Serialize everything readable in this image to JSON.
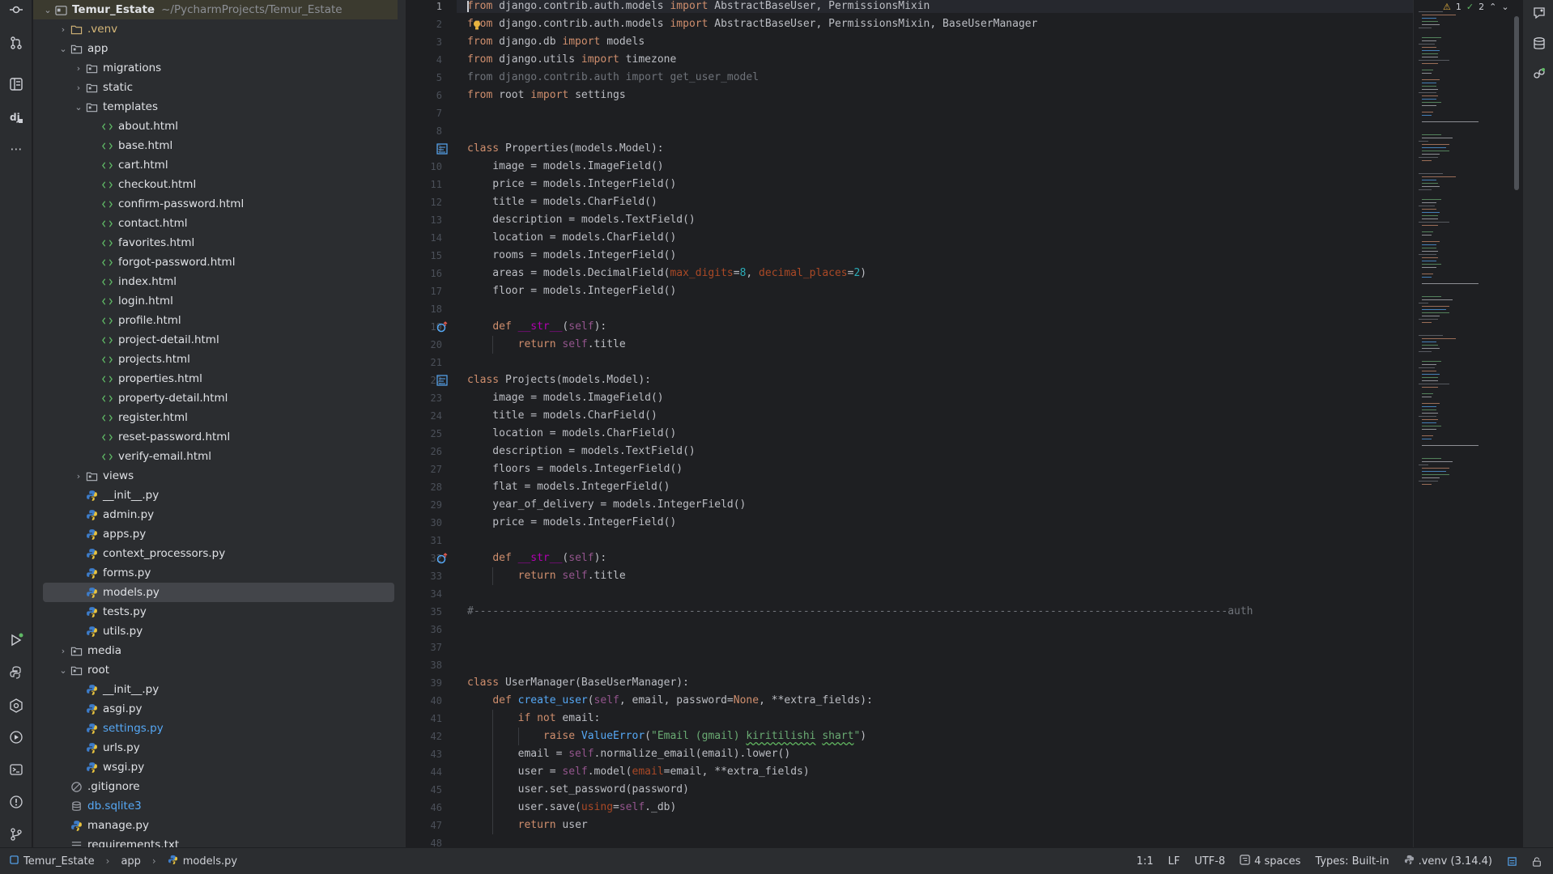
{
  "project_tree": {
    "root_name": "Temur_Estate",
    "root_path": "~/PycharmProjects/Temur_Estate",
    "items": [
      {
        "label": ".venv",
        "depth": 1,
        "type": "folder-venv",
        "expanded": false
      },
      {
        "label": "app",
        "depth": 1,
        "type": "folder",
        "expanded": true
      },
      {
        "label": "migrations",
        "depth": 2,
        "type": "folder",
        "expanded": false
      },
      {
        "label": "static",
        "depth": 2,
        "type": "folder",
        "expanded": false
      },
      {
        "label": "templates",
        "depth": 2,
        "type": "folder",
        "expanded": true
      },
      {
        "label": "about.html",
        "depth": 3,
        "type": "html"
      },
      {
        "label": "base.html",
        "depth": 3,
        "type": "html"
      },
      {
        "label": "cart.html",
        "depth": 3,
        "type": "html"
      },
      {
        "label": "checkout.html",
        "depth": 3,
        "type": "html"
      },
      {
        "label": "confirm-password.html",
        "depth": 3,
        "type": "html"
      },
      {
        "label": "contact.html",
        "depth": 3,
        "type": "html"
      },
      {
        "label": "favorites.html",
        "depth": 3,
        "type": "html"
      },
      {
        "label": "forgot-password.html",
        "depth": 3,
        "type": "html"
      },
      {
        "label": "index.html",
        "depth": 3,
        "type": "html"
      },
      {
        "label": "login.html",
        "depth": 3,
        "type": "html"
      },
      {
        "label": "profile.html",
        "depth": 3,
        "type": "html"
      },
      {
        "label": "project-detail.html",
        "depth": 3,
        "type": "html"
      },
      {
        "label": "projects.html",
        "depth": 3,
        "type": "html"
      },
      {
        "label": "properties.html",
        "depth": 3,
        "type": "html"
      },
      {
        "label": "property-detail.html",
        "depth": 3,
        "type": "html"
      },
      {
        "label": "register.html",
        "depth": 3,
        "type": "html"
      },
      {
        "label": "reset-password.html",
        "depth": 3,
        "type": "html"
      },
      {
        "label": "verify-email.html",
        "depth": 3,
        "type": "html"
      },
      {
        "label": "views",
        "depth": 2,
        "type": "folder",
        "expanded": false
      },
      {
        "label": "__init__.py",
        "depth": 2,
        "type": "py"
      },
      {
        "label": "admin.py",
        "depth": 2,
        "type": "py"
      },
      {
        "label": "apps.py",
        "depth": 2,
        "type": "py"
      },
      {
        "label": "context_processors.py",
        "depth": 2,
        "type": "py"
      },
      {
        "label": "forms.py",
        "depth": 2,
        "type": "py"
      },
      {
        "label": "models.py",
        "depth": 2,
        "type": "py",
        "selected": true
      },
      {
        "label": "tests.py",
        "depth": 2,
        "type": "py"
      },
      {
        "label": "utils.py",
        "depth": 2,
        "type": "py"
      },
      {
        "label": "media",
        "depth": 1,
        "type": "folder",
        "expanded": false
      },
      {
        "label": "root",
        "depth": 1,
        "type": "folder",
        "expanded": true
      },
      {
        "label": "__init__.py",
        "depth": 2,
        "type": "py"
      },
      {
        "label": "asgi.py",
        "depth": 2,
        "type": "py"
      },
      {
        "label": "settings.py",
        "depth": 2,
        "type": "py",
        "modified": true
      },
      {
        "label": "urls.py",
        "depth": 2,
        "type": "py"
      },
      {
        "label": "wsgi.py",
        "depth": 2,
        "type": "py"
      },
      {
        "label": ".gitignore",
        "depth": 1,
        "type": "ignore"
      },
      {
        "label": "db.sqlite3",
        "depth": 1,
        "type": "db",
        "modified": true
      },
      {
        "label": "manage.py",
        "depth": 1,
        "type": "py"
      },
      {
        "label": "requirements.txt",
        "depth": 1,
        "type": "txt"
      }
    ]
  },
  "editor": {
    "file": "models.py",
    "current_line": 1,
    "lines": [
      "[[kw:from]] django.contrib.auth.models [[kw:import]] AbstractBaseUser, PermissionsMixin",
      "[[kw:from]] django.contrib.auth.models [[kw:import]] AbstractBaseUser, PermissionsMixin, BaseUserManager",
      "[[kw:from]] django.db [[kw:import]] models",
      "[[kw:from]] django.utils [[kw:import]] timezone",
      "[[dim:from django.contrib.auth import get_user_model]]",
      "[[kw:from]] root [[kw:import]] settings",
      "",
      "",
      "[[kw:class]] Properties(models.Model):",
      "    image = models.ImageField()",
      "    price = models.IntegerField()",
      "    title = models.CharField()",
      "    description = models.TextField()",
      "    location = models.CharField()",
      "    rooms = models.IntegerField()",
      "    areas = models.DecimalField([[prm:max_digits]]=[[num:8]], [[prm:decimal_places]]=[[num:2]])",
      "    floor = models.IntegerField()",
      "",
      "    [[kw:def]] [[dunder:__str__]]([[slf:self]]):",
      "        [[kw:return]] [[slf:self]].title",
      "",
      "[[kw:class]] Projects(models.Model):",
      "    image = models.ImageField()",
      "    title = models.CharField()",
      "    location = models.CharField()",
      "    description = models.TextField()",
      "    floors = models.IntegerField()",
      "    flat = models.IntegerField()",
      "    year_of_delivery = models.IntegerField()",
      "    price = models.IntegerField()",
      "",
      "    [[kw:def]] [[dunder:__str__]]([[slf:self]]):",
      "        [[kw:return]] [[slf:self]].title",
      "",
      "[[dim:#-----------------------------------------------------------------------------------------------------------------------auth]]",
      "",
      "",
      "",
      "[[kw:class]] UserManager(BaseUserManager):",
      "    [[kw:def]] [[fn:create_user]]([[slf:self]], email, password=[[kw:None]], **extra_fields):",
      "        [[kw:if not]] email:",
      "            [[kw:raise]] [[fn:ValueError]]([[str:\"Email (gmail) ]][[typo:kiritilishi]][[str: ]][[typo:shart]][[str:\"]])",
      "        email = [[slf:self]].normalize_email(email).lower()",
      "        user = [[slf:self]].model([[prm:email]]=email, **extra_fields)",
      "        user.set_password(password)",
      "        user.save([[prm:using]]=[[slf:self]]._db)",
      "        [[kw:return]] user",
      ""
    ]
  },
  "inspections": {
    "warnings": "1",
    "weak_warnings": "2"
  },
  "statusbar": {
    "crumbs": [
      "Temur_Estate",
      "app",
      "models.py"
    ],
    "position": "1:1",
    "line_sep": "LF",
    "encoding": "UTF-8",
    "indent": "4 spaces",
    "types": "Types: Built-in",
    "interpreter": ".venv (3.14.4)"
  },
  "colors": {
    "keyword": "#cf8e6d",
    "function": "#56a8f5",
    "self": "#94558d",
    "param": "#aa4926",
    "number": "#2aacb8",
    "string": "#6aab73",
    "dim": "#6f737a"
  }
}
